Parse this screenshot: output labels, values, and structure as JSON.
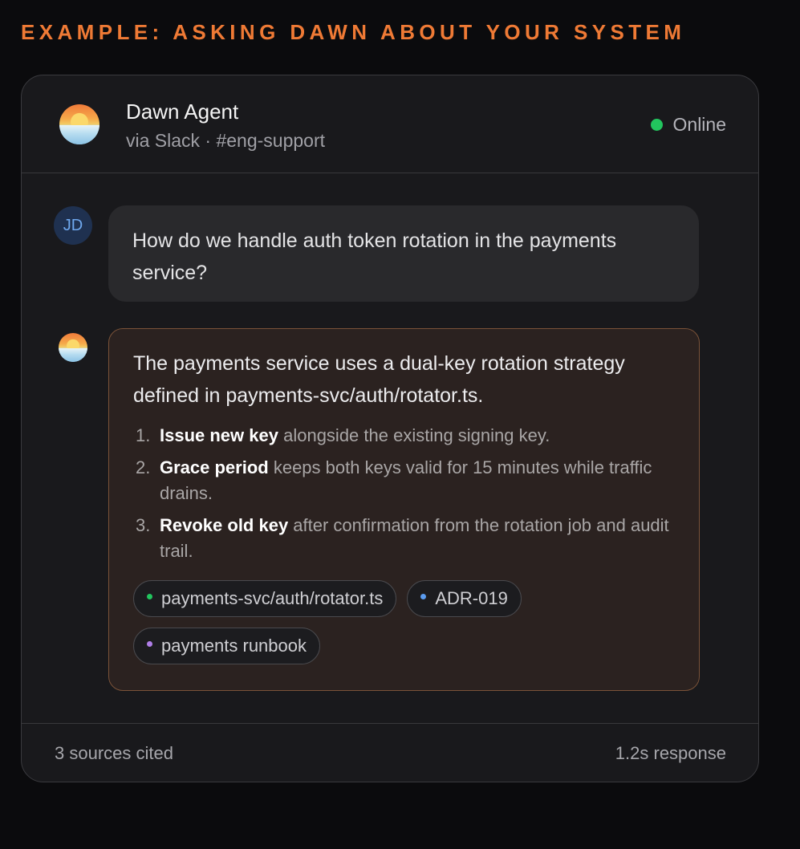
{
  "section_label": "EXAMPLE: ASKING DAWN ABOUT YOUR SYSTEM",
  "header": {
    "agent_name": "Dawn Agent",
    "subtitle": "via Slack · #eng-support",
    "status_text": "Online",
    "status_color": "#22c55e"
  },
  "user_message": {
    "initials": "JD",
    "text": "How do we handle auth token rotation in the payments service?"
  },
  "agent_message": {
    "intro": "The payments service uses a dual-key rotation strategy defined in payments-svc/auth/rotator.ts.",
    "steps": [
      {
        "num": "1.",
        "title": "Issue new key",
        "detail": " alongside the existing signing key."
      },
      {
        "num": "2.",
        "title": "Grace period",
        "detail": " keeps both keys valid for 15 minutes while traffic drains."
      },
      {
        "num": "3.",
        "title": "Revoke old key",
        "detail": " after confirmation from the rotation job and audit trail."
      }
    ],
    "sources": [
      {
        "label": "payments-svc/auth/rotator.ts",
        "dot_color": "#22c55e"
      },
      {
        "label": "ADR-019",
        "dot_color": "#5b9cf0"
      },
      {
        "label": "payments runbook",
        "dot_color": "#b07ee8"
      }
    ]
  },
  "footer": {
    "sources_count": "3 sources cited",
    "response_time": "1.2s response"
  },
  "colors": {
    "accent": "#ef7a35",
    "agent_bubble_border": "#7a5238"
  }
}
